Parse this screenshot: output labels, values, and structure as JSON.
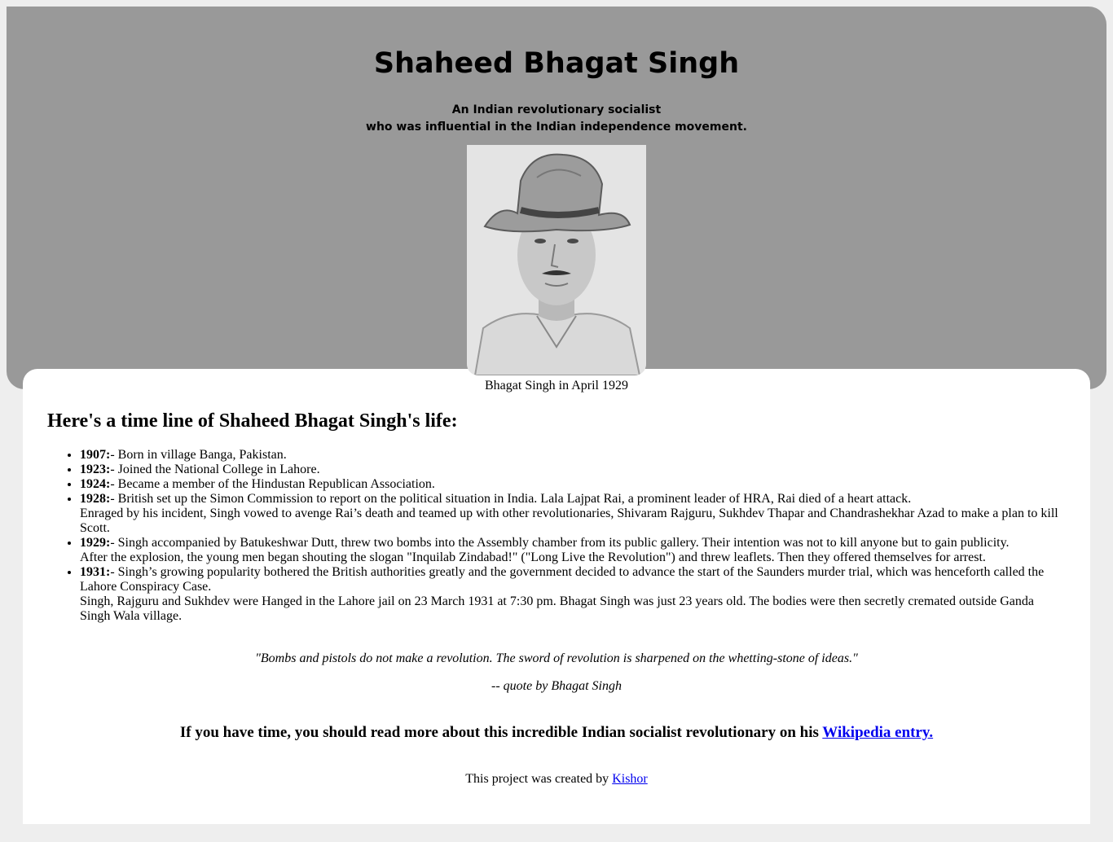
{
  "header": {
    "title": "Shaheed Bhagat Singh",
    "subtitle_line1": "An Indian revolutionary socialist",
    "subtitle_line2": "who was influential in the Indian independence movement."
  },
  "image": {
    "caption": "Bhagat Singh in April 1929"
  },
  "timeline": {
    "heading": "Here's a time line of Shaheed Bhagat Singh's life:",
    "items": [
      {
        "year": "1907:",
        "text": "- Born in village Banga, Pakistan.",
        "extra": []
      },
      {
        "year": "1923:",
        "text": "- Joined the National College in Lahore.",
        "extra": []
      },
      {
        "year": "1924:",
        "text": "- Became a member of the Hindustan Republican Association.",
        "extra": []
      },
      {
        "year": "1928:",
        "text": "- British set up the Simon Commission to report on the political situation in India. Lala Lajpat Rai, a prominent leader of HRA, Rai died of a heart attack.",
        "extra": [
          "Enraged by his incident, Singh vowed to avenge Rai’s death and teamed up with other revolutionaries, Shivaram Rajguru, Sukhdev Thapar and Chandrashekhar Azad to make a plan to kill Scott."
        ]
      },
      {
        "year": "1929:",
        "text": "- Singh accompanied by Batukeshwar Dutt, threw two bombs into the Assembly chamber from its public gallery. Their intention was not to kill anyone but to gain publicity.",
        "extra": [
          "After the explosion, the young men began shouting the slogan \"Inquilab Zindabad!\" (\"Long Live the Revolution\") and threw leaflets. Then they offered themselves for arrest."
        ]
      },
      {
        "year": "1931:",
        "text": "- Singh’s growing popularity bothered the British authorities greatly and the government decided to advance the start of the Saunders murder trial, which was henceforth called the Lahore Conspiracy Case.",
        "extra": [
          "Singh, Rajguru and Sukhdev were Hanged in the Lahore jail on 23 March 1931 at 7:30 pm. Bhagat Singh was just 23 years old. The bodies were then secretly cremated outside Ganda Singh Wala village."
        ]
      }
    ]
  },
  "quote": {
    "text": "\"Bombs and pistols do not make a revolution. The sword of revolution is sharpened on the whetting-stone of ideas.\"",
    "author": "-- quote by Bhagat Singh"
  },
  "more": {
    "text": "If you have time, you should read more about this incredible Indian socialist revolutionary on his ",
    "link_label": "Wikipedia entry."
  },
  "footer": {
    "text": "This project was created by ",
    "link_label": "Kishor"
  }
}
